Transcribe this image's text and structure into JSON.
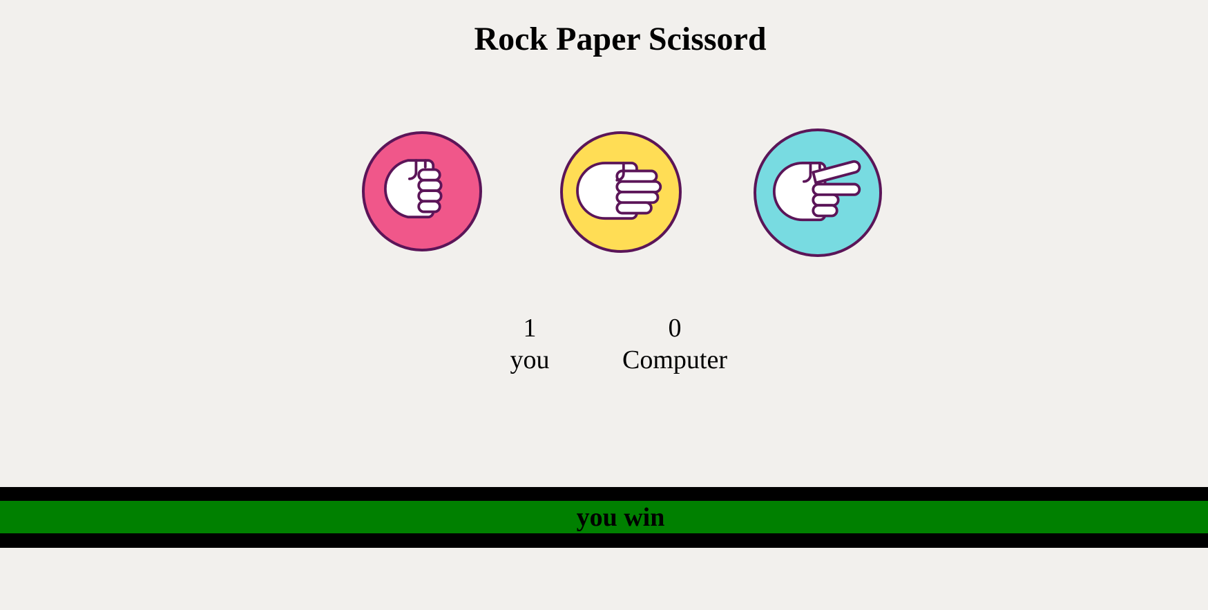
{
  "title": "Rock Paper Scissord",
  "choices": [
    {
      "name": "rock",
      "icon": "rock-fist-icon",
      "color": "#f0578a"
    },
    {
      "name": "paper",
      "icon": "paper-hand-icon",
      "color": "#ffdd55"
    },
    {
      "name": "scissors",
      "icon": "scissors-hand-icon",
      "color": "#78dbe1"
    }
  ],
  "scoreboard": {
    "user_score": "1",
    "user_label": "you",
    "computer_score": "0",
    "computer_label": "Computer"
  },
  "result": {
    "message": "you win",
    "color": "#008000"
  }
}
